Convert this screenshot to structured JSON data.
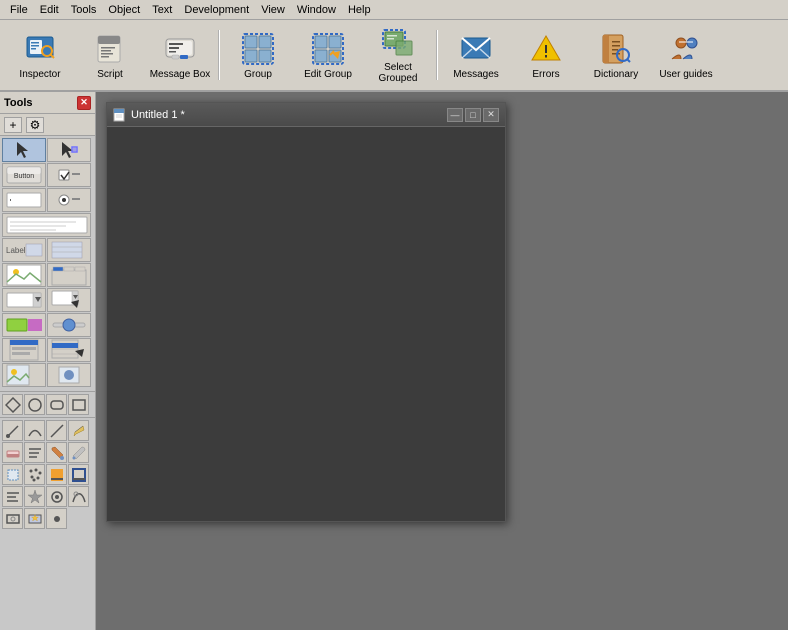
{
  "menubar": {
    "items": [
      "File",
      "Edit",
      "Tools",
      "Object",
      "Text",
      "Development",
      "View",
      "Window",
      "Help"
    ]
  },
  "toolbar": {
    "buttons": [
      {
        "id": "inspector",
        "label": "Inspector",
        "icon": "inspector-icon"
      },
      {
        "id": "script",
        "label": "Script",
        "icon": "script-icon"
      },
      {
        "id": "message-box",
        "label": "Message Box",
        "icon": "messagebox-icon"
      },
      {
        "id": "group",
        "label": "Group",
        "icon": "group-icon"
      },
      {
        "id": "edit-group",
        "label": "Edit Group",
        "icon": "editgroup-icon"
      },
      {
        "id": "select-grouped",
        "label": "Select Grouped",
        "icon": "selectgrouped-icon"
      },
      {
        "id": "messages",
        "label": "Messages",
        "icon": "messages-icon"
      },
      {
        "id": "errors",
        "label": "Errors",
        "icon": "errors-icon"
      },
      {
        "id": "dictionary",
        "label": "Dictionary",
        "icon": "dictionary-icon"
      },
      {
        "id": "user-guides",
        "label": "User guides",
        "icon": "userguides-icon"
      }
    ]
  },
  "tools": {
    "title": "Tools",
    "add_label": "+",
    "settings_label": "⚙"
  },
  "document": {
    "title": "Untitled 1 *",
    "icon": "📄"
  }
}
